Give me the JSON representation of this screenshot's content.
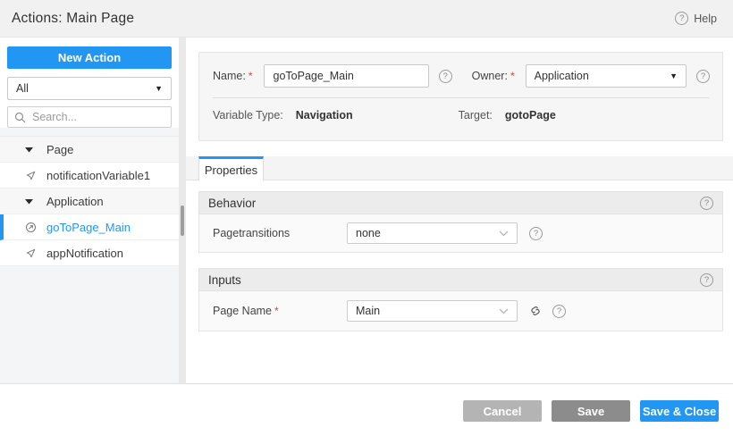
{
  "header": {
    "title": "Actions: Main Page",
    "help_label": "Help",
    "help_glyph": "?"
  },
  "sidebar": {
    "new_action_label": "New Action",
    "filter_value": "All",
    "search_placeholder": "Search...",
    "tree": [
      {
        "type": "group",
        "label": "Page"
      },
      {
        "type": "item",
        "label": "notificationVariable1",
        "icon": "variable-icon",
        "selected": false
      },
      {
        "type": "group",
        "label": "Application"
      },
      {
        "type": "item",
        "label": "goToPage_Main",
        "icon": "action-icon",
        "selected": true
      },
      {
        "type": "item",
        "label": "appNotification",
        "icon": "variable-icon",
        "selected": false
      }
    ]
  },
  "form": {
    "required_marker": "*",
    "name_label": "Name:",
    "name_value": "goToPage_Main",
    "owner_label": "Owner:",
    "owner_value": "Application",
    "variable_type_label": "Variable Type:",
    "variable_type_value": "Navigation",
    "target_label": "Target:",
    "target_value": "gotoPage"
  },
  "tabs": [
    {
      "label": "Properties",
      "active": true
    }
  ],
  "sections": [
    {
      "title": "Behavior",
      "fields": [
        {
          "label": "Pagetransitions",
          "value": "none",
          "required": false,
          "has_link": false
        }
      ]
    },
    {
      "title": "Inputs",
      "fields": [
        {
          "label": "Page Name",
          "value": "Main",
          "required": true,
          "has_link": true
        }
      ]
    }
  ],
  "footer": {
    "cancel_label": "Cancel",
    "save_label": "Save",
    "save_close_label": "Save & Close"
  },
  "colors": {
    "accent": "#2196f3",
    "cancel_button": "#b4b4b4",
    "save_button": "#8c8c8c",
    "header_bg": "#f1f1f2",
    "panel_bg": "#f6f6f7",
    "section_header_bg": "#ececed"
  }
}
